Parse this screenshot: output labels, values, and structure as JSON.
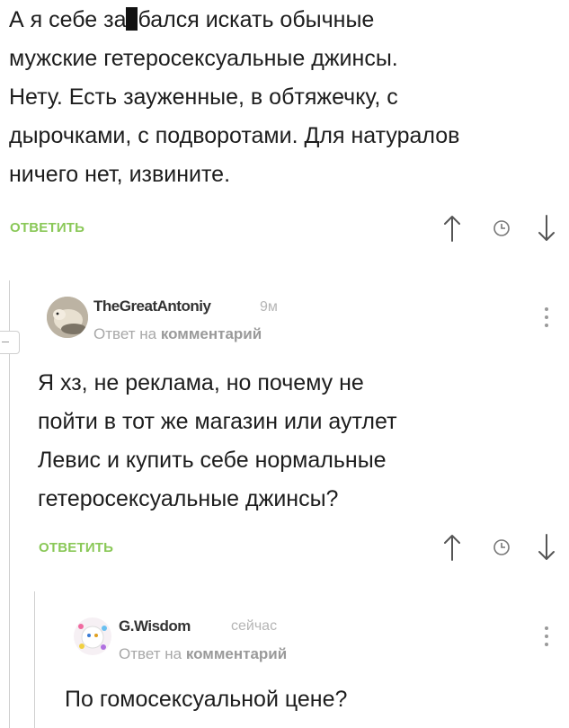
{
  "comment1": {
    "text_before_censor": "А я себе за",
    "text_after_censor": "бался искать обычные",
    "lines": [
      "мужские гетеросексуальные джинсы.",
      "Нету. Есть зауженные, в обтяжечку, с",
      "дырочками, с подворотами. Для натуралов",
      "ничего нет, извините."
    ],
    "reply_label": "ОТВЕТИТЬ"
  },
  "comment2": {
    "author": "TheGreatAntoniy",
    "time": "9м",
    "reply_prefix": "Ответ на",
    "reply_target": "комментарий",
    "lines": [
      "Я хз, не реклама, но почему не",
      "пойти в тот же магазин или аутлет",
      "Левис и купить себе нормальные",
      "гетеросексуальные джинсы?"
    ],
    "reply_label": "ОТВЕТИТЬ"
  },
  "comment3": {
    "author": "G.Wisdom",
    "time": "сейчас",
    "reply_prefix": "Ответ на",
    "reply_target": "комментарий",
    "lines": [
      "По гомосексуальной цене?"
    ]
  },
  "icons": {
    "upvote": "arrow-up-icon",
    "clock": "clock-icon",
    "downvote": "arrow-down-icon",
    "more": "more-vertical-icon",
    "collapse": "collapse-minus-icon"
  },
  "colors": {
    "reply_green": "#8ac858",
    "meta_gray": "#a8a8a8",
    "text": "#1d1d1d"
  }
}
